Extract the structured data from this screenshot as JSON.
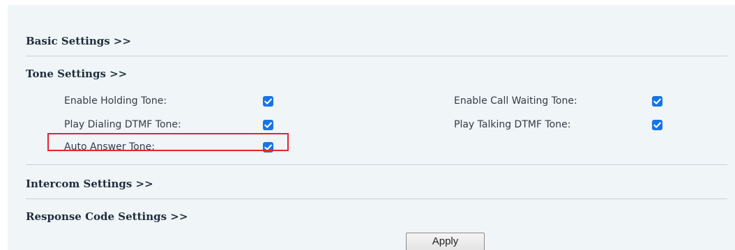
{
  "sections": {
    "basic": "Basic Settings >>",
    "tone": "Tone Settings >>",
    "intercom": "Intercom Settings >>",
    "response": "Response Code Settings >>"
  },
  "tone_settings": {
    "enable_holding_tone": {
      "label": "Enable Holding Tone:",
      "checked": true
    },
    "play_dialing_dtmf_tone": {
      "label": "Play Dialing DTMF Tone:",
      "checked": true
    },
    "auto_answer_tone": {
      "label": "Auto Answer Tone:",
      "checked": true
    },
    "enable_call_waiting_tone": {
      "label": "Enable Call Waiting Tone:",
      "checked": true
    },
    "play_talking_dtmf_tone": {
      "label": "Play Talking DTMF Tone:",
      "checked": true
    }
  },
  "apply_label": "Apply",
  "colors": {
    "checkbox": "#1a73e8",
    "highlight_border": "#e8232a",
    "panel_background": "#f0f5f8"
  }
}
